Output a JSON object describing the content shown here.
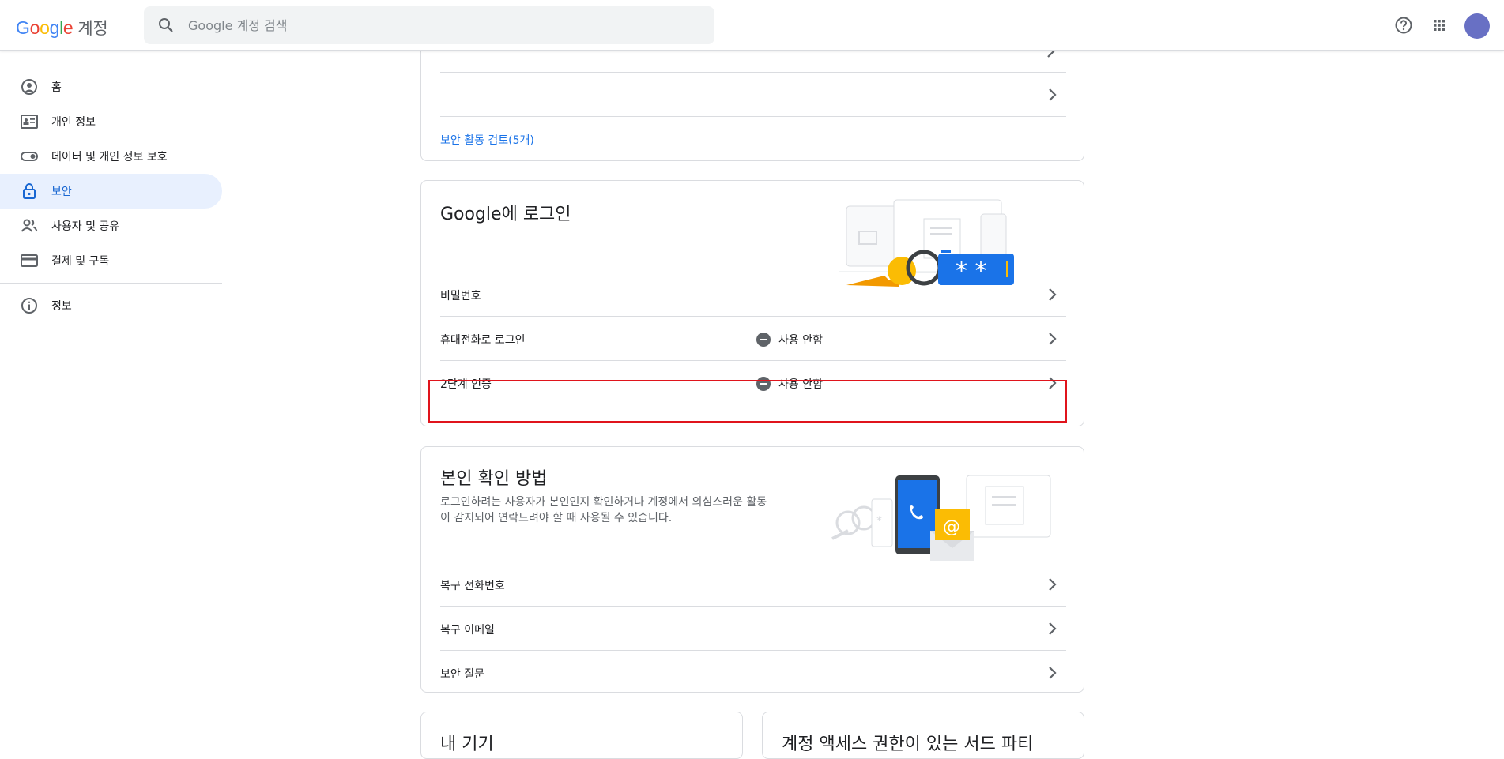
{
  "header": {
    "logo_google": [
      "G",
      "o",
      "o",
      "g",
      "l",
      "e"
    ],
    "logo_suffix": "계정",
    "search_placeholder": "Google 계정 검색"
  },
  "sidebar": {
    "items": [
      {
        "label": "홈",
        "icon": "account-circle-icon"
      },
      {
        "label": "개인 정보",
        "icon": "badge-icon"
      },
      {
        "label": "데이터 및 개인 정보 보호",
        "icon": "toggle-icon"
      },
      {
        "label": "보안",
        "icon": "lock-icon",
        "active": true
      },
      {
        "label": "사용자 및 공유",
        "icon": "people-icon"
      },
      {
        "label": "결제 및 구독",
        "icon": "credit-card-icon"
      },
      {
        "label": "정보",
        "icon": "info-icon"
      }
    ]
  },
  "security_activity": {
    "review_link": "보안 활동 검토(5개)"
  },
  "signin": {
    "title": "Google에 로그인",
    "rows": [
      {
        "label": "비밀번호",
        "status": ""
      },
      {
        "label": "휴대전화로 로그인",
        "status": "사용 안함"
      },
      {
        "label": "2단계 인증",
        "status": "사용 안함"
      }
    ]
  },
  "verify": {
    "title": "본인 확인 방법",
    "desc_line1": "로그인하려는 사용자가 본인인지 확인하거나 계정에서 의심스러운 활동",
    "desc_line2": "이 감지되어 연락드려야 할 때 사용될 수 있습니다.",
    "rows": [
      {
        "label": "복구 전화번호"
      },
      {
        "label": "복구 이메일"
      },
      {
        "label": "보안 질문"
      }
    ]
  },
  "bottom_cards": {
    "left_title": "내 기기",
    "right_title": "계정 액세스 권한이 있는 서드 파티"
  },
  "colors": {
    "accent": "#1a73e8",
    "active_bg": "#e8f0fe",
    "highlight": "#e0141c",
    "avatar": "#6870c4"
  }
}
